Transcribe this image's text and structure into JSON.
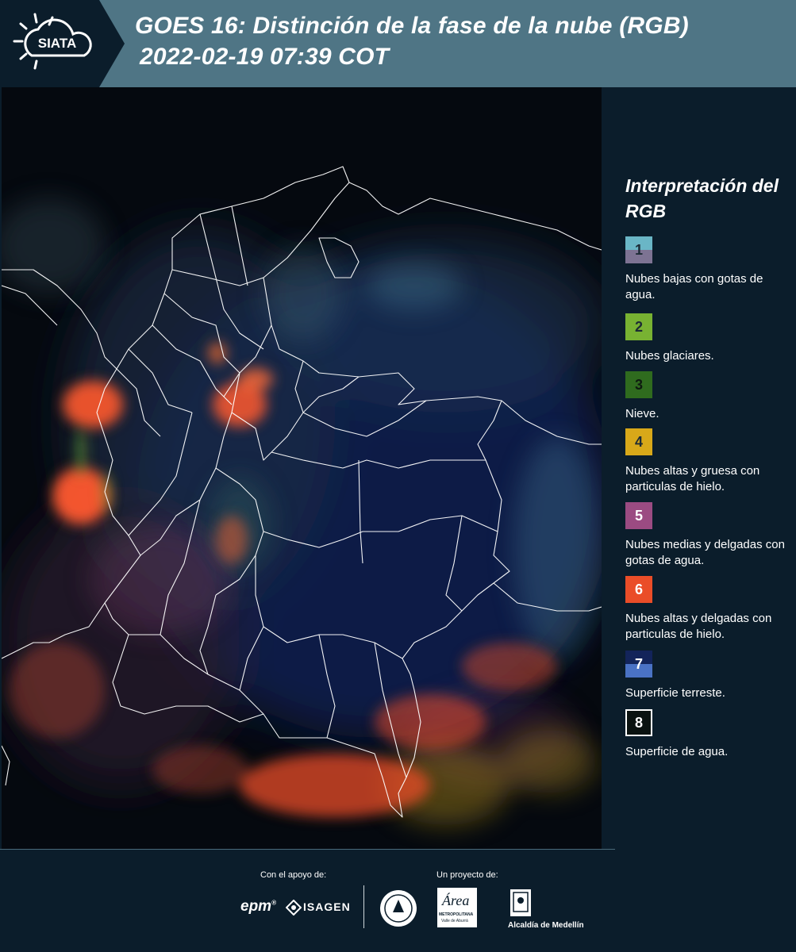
{
  "header": {
    "logo_text": "SIATA",
    "title_line1": "GOES 16: Distinción de la fase de la nube (RGB)",
    "title_line2": "2022-02-19 07:39 COT"
  },
  "legend": {
    "title": "Interpretación del RGB",
    "items": [
      {
        "number": "1",
        "label": "Nubes bajas con gotas de agua.",
        "color_top": "#6ab6c6",
        "color_bottom": "#7d7393"
      },
      {
        "number": "2",
        "label": "Nubes glaciares.",
        "color": "#78b232"
      },
      {
        "number": "3",
        "label": "Nieve.",
        "color": "#2f6b1e"
      },
      {
        "number": "4",
        "label": "Nubes altas y gruesa con particulas de hielo.",
        "color": "#d8a819"
      },
      {
        "number": "5",
        "label": "Nubes medias y delgadas con gotas de agua.",
        "color": "#9b4b82"
      },
      {
        "number": "6",
        "label": "Nubes altas y delgadas con particulas de hielo.",
        "color": "#ea4d28"
      },
      {
        "number": "7",
        "label": "Superficie terreste.",
        "color_top": "#13245a",
        "color_bottom": "#4a72c4"
      },
      {
        "number": "8",
        "label": "Superficie de agua.",
        "color": "#0a1210"
      }
    ]
  },
  "footer": {
    "support_label": "Con el apoyo de:",
    "project_label": "Un proyecto de:",
    "sponsor_epm": "epm",
    "sponsor_isagen": "ISAGEN",
    "area_logo": "Área",
    "area_sub": "METROPOLITANA",
    "area_sub2": "Valle de Aburrá",
    "medellin": "Alcaldía de Medellín"
  },
  "colors": {
    "header_bg": "#4f7585",
    "panel_bg": "#0b1d2b",
    "cloud_ice": "#ea4d28",
    "land": "#13245a",
    "water": "#05090f"
  }
}
